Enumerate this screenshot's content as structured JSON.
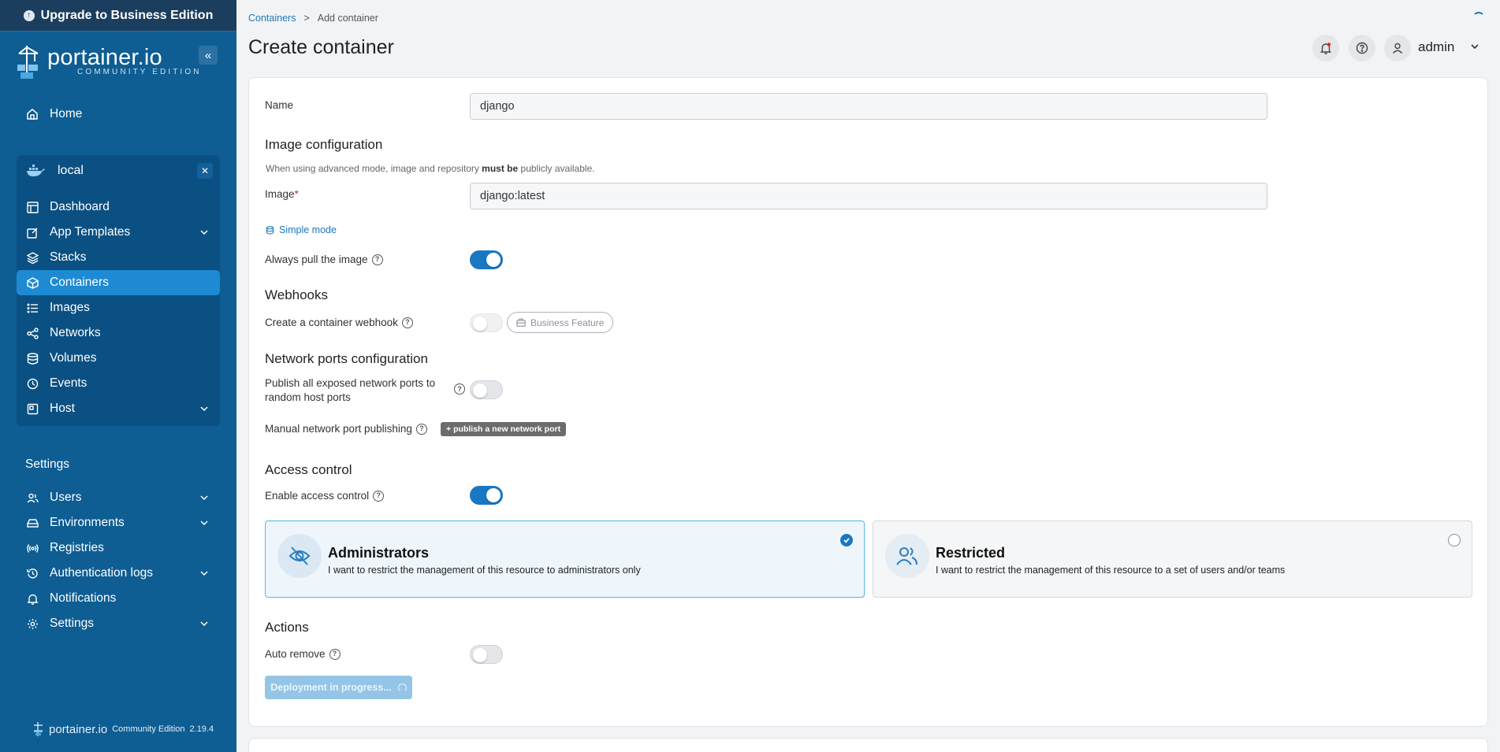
{
  "upgrade": {
    "label": "Upgrade to Business Edition"
  },
  "brand": {
    "name": "portainer.io",
    "edition": "COMMUNITY EDITION"
  },
  "sidebar": {
    "home": "Home",
    "environment": {
      "name": "local",
      "items": [
        {
          "label": "Dashboard"
        },
        {
          "label": "App Templates"
        },
        {
          "label": "Stacks"
        },
        {
          "label": "Containers"
        },
        {
          "label": "Images"
        },
        {
          "label": "Networks"
        },
        {
          "label": "Volumes"
        },
        {
          "label": "Events"
        },
        {
          "label": "Host"
        }
      ]
    },
    "settings_header": "Settings",
    "settings_items": [
      {
        "label": "Users"
      },
      {
        "label": "Environments"
      },
      {
        "label": "Registries"
      },
      {
        "label": "Authentication logs"
      },
      {
        "label": "Notifications"
      },
      {
        "label": "Settings"
      }
    ]
  },
  "footer": {
    "brand": "portainer.io",
    "edition": "Community Edition",
    "version": "2.19.4"
  },
  "header": {
    "breadcrumb": {
      "link": "Containers",
      "separator": ">",
      "current": "Add container"
    },
    "title": "Create container",
    "user": "admin"
  },
  "form": {
    "name": {
      "label": "Name",
      "value": "django"
    },
    "image_config": {
      "title": "Image configuration",
      "note_before": "When using advanced mode, image and repository ",
      "note_bold": "must be",
      "note_after": " publicly available.",
      "image_label": "Image",
      "image_required": "*",
      "image_value": "django:latest",
      "simple_mode": "Simple mode",
      "always_pull_label": "Always pull the image",
      "always_pull": true
    },
    "webhooks": {
      "title": "Webhooks",
      "create_label": "Create a container webhook",
      "business_feature": "Business Feature"
    },
    "network_ports": {
      "title": "Network ports configuration",
      "publish_all_line1": "Publish all exposed network ports to",
      "publish_all_line2": "random host ports",
      "manual_label": "Manual network port publishing",
      "publish_button": "publish a new network port"
    },
    "access_control": {
      "title": "Access control",
      "enable_label": "Enable access control",
      "enabled": true,
      "admin_card": {
        "title": "Administrators",
        "desc": "I want to restrict the management of this resource to administrators only"
      },
      "restricted_card": {
        "title": "Restricted",
        "desc": "I want to restrict the management of this resource to a set of users and/or teams"
      }
    },
    "actions": {
      "title": "Actions",
      "auto_remove_label": "Auto remove",
      "deploy_button": "Deployment in progress..."
    }
  },
  "colors": {
    "sidebar": "#0e5d93",
    "accent": "#1a78c2",
    "active_nav": "#1d8ad3"
  }
}
